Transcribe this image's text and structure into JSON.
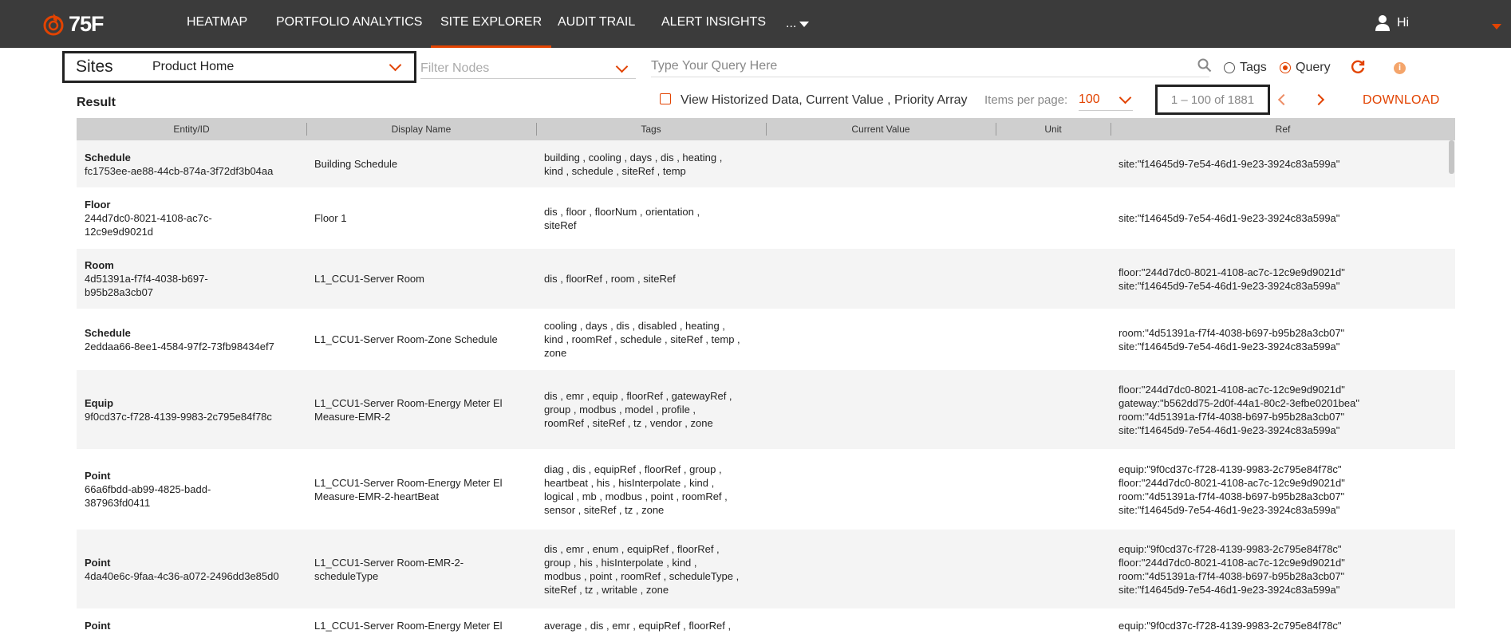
{
  "brand": {
    "logo_text": "75F",
    "accent_color": "#e24301",
    "nav_bg": "#3b3b3b"
  },
  "nav": {
    "items": [
      "HEATMAP",
      "PORTFOLIO ANALYTICS",
      "SITE EXPLORER",
      "AUDIT TRAIL",
      "ALERT INSIGHTS"
    ],
    "more": "...",
    "active": "SITE EXPLORER",
    "user_greeting": "Hi"
  },
  "toolbar": {
    "sites_label": "Sites",
    "site_value": "Product Home",
    "filter_placeholder": "Filter Nodes",
    "query_placeholder": "Type Your Query Here",
    "radio_tags": "Tags",
    "radio_query": "Query",
    "radio_selected": "Query"
  },
  "results": {
    "label": "Result",
    "historized_label": "View Historized Data, Current Value , Priority Array",
    "items_per_page_label": "Items per page:",
    "items_per_page": "100",
    "range": "1 – 100 of 1881",
    "download": "DOWNLOAD"
  },
  "table": {
    "columns": [
      "Entity/ID",
      "Display Name",
      "Tags",
      "Current Value",
      "Unit",
      "Ref"
    ],
    "rows": [
      {
        "type": "Schedule",
        "id": "fc1753ee-ae88-44cb-874a-3f72df3b04aa",
        "display": "Building Schedule",
        "tags": "building , cooling , days , dis , heating ,\nkind , schedule , siteRef , temp",
        "current": "",
        "unit": "",
        "ref": "site:\"f14645d9-7e54-46d1-9e23-3924c83a599a\""
      },
      {
        "type": "Floor",
        "id": "244d7dc0-8021-4108-ac7c-\n12c9e9d9021d",
        "display": "Floor 1",
        "tags": "dis , floor , floorNum , orientation ,\nsiteRef",
        "current": "",
        "unit": "",
        "ref": "site:\"f14645d9-7e54-46d1-9e23-3924c83a599a\""
      },
      {
        "type": "Room",
        "id": "4d51391a-f7f4-4038-b697-\nb95b28a3cb07",
        "display": "L1_CCU1-Server Room",
        "tags": "dis , floorRef , room , siteRef",
        "current": "",
        "unit": "",
        "ref": "floor:\"244d7dc0-8021-4108-ac7c-12c9e9d9021d\"\nsite:\"f14645d9-7e54-46d1-9e23-3924c83a599a\""
      },
      {
        "type": "Schedule",
        "id": "2eddaa66-8ee1-4584-97f2-73fb98434ef7",
        "display": "L1_CCU1-Server Room-Zone Schedule",
        "tags": "cooling , days , dis , disabled , heating ,\nkind , roomRef , schedule , siteRef , temp ,\nzone",
        "current": "",
        "unit": "",
        "ref": "room:\"4d51391a-f7f4-4038-b697-b95b28a3cb07\"\nsite:\"f14645d9-7e54-46d1-9e23-3924c83a599a\""
      },
      {
        "type": "Equip",
        "id": "9f0cd37c-f728-4139-9983-2c795e84f78c",
        "display": "L1_CCU1-Server Room-Energy Meter El\nMeasure-EMR-2",
        "tags": "dis , emr , equip , floorRef , gatewayRef ,\ngroup , modbus , model , profile ,\nroomRef , siteRef , tz , vendor , zone",
        "current": "",
        "unit": "",
        "ref": "floor:\"244d7dc0-8021-4108-ac7c-12c9e9d9021d\"\ngateway:\"b562dd75-2d0f-44a1-80c2-3efbe0201bea\"\nroom:\"4d51391a-f7f4-4038-b697-b95b28a3cb07\"\nsite:\"f14645d9-7e54-46d1-9e23-3924c83a599a\""
      },
      {
        "type": "Point",
        "id": "66a6fbdd-ab99-4825-badd-\n387963fd0411",
        "display": "L1_CCU1-Server Room-Energy Meter El\nMeasure-EMR-2-heartBeat",
        "tags": "diag , dis , equipRef , floorRef , group ,\nheartbeat , his , hisInterpolate , kind ,\nlogical , mb , modbus , point , roomRef ,\nsensor , siteRef , tz , zone",
        "current": "",
        "unit": "",
        "ref": "equip:\"9f0cd37c-f728-4139-9983-2c795e84f78c\"\nfloor:\"244d7dc0-8021-4108-ac7c-12c9e9d9021d\"\nroom:\"4d51391a-f7f4-4038-b697-b95b28a3cb07\"\nsite:\"f14645d9-7e54-46d1-9e23-3924c83a599a\""
      },
      {
        "type": "Point",
        "id": "4da40e6c-9faa-4c36-a072-2496dd3e85d0",
        "display": "L1_CCU1-Server Room-EMR-2-\nscheduleType",
        "tags": "dis , emr , enum , equipRef , floorRef ,\ngroup , his , hisInterpolate , kind ,\nmodbus , point , roomRef , scheduleType ,\nsiteRef , tz , writable , zone",
        "current": "",
        "unit": "",
        "ref": "equip:\"9f0cd37c-f728-4139-9983-2c795e84f78c\"\nfloor:\"244d7dc0-8021-4108-ac7c-12c9e9d9021d\"\nroom:\"4d51391a-f7f4-4038-b697-b95b28a3cb07\"\nsite:\"f14645d9-7e54-46d1-9e23-3924c83a599a\""
      },
      {
        "type": "Point",
        "id": "",
        "display": "L1_CCU1-Server Room-Energy Meter El",
        "tags": "average , dis , emr , equipRef , floorRef ,",
        "current": "",
        "unit": "",
        "ref": "equip:\"9f0cd37c-f728-4139-9983-2c795e84f78c\""
      }
    ]
  }
}
